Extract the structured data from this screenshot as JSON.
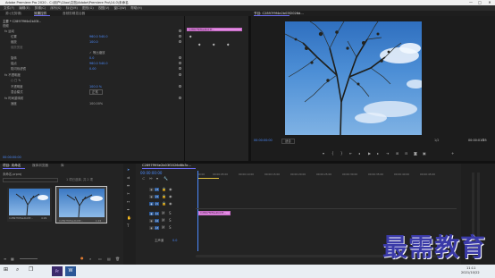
{
  "window": {
    "title": "Adobe Premiere Pro 2020 - C:\\用户\\Ciloo\\文档\\Adobe\\Premiere Pro\\14.0\\未命名",
    "min": "—",
    "max": "□",
    "close": "✕"
  },
  "menu": [
    "文件(F)",
    "编辑(E)",
    "剪辑(C)",
    "序列(S)",
    "标记(M)",
    "图形(G)",
    "视图(V)",
    "窗口(W)",
    "帮助(H)"
  ],
  "effect_controls": {
    "tabs": [
      "源:(无剪辑)",
      "效果控件",
      "音频剪辑混合器"
    ],
    "active_tab": 1,
    "header": "主要 * C2897f9f4e2b03f...",
    "clip_label": "视频",
    "rows": [
      {
        "indent": 0,
        "label": "fx 运动",
        "value": ""
      },
      {
        "indent": 1,
        "label": "位置",
        "value": "960.0    540.0"
      },
      {
        "indent": 1,
        "label": "缩放",
        "value": "100.0"
      },
      {
        "indent": 1,
        "label": "缩放宽度",
        "value": ""
      },
      {
        "indent": 2,
        "label": "",
        "value": "✓ 等比缩放"
      },
      {
        "indent": 1,
        "label": "旋转",
        "value": "0.0"
      },
      {
        "indent": 1,
        "label": "锚点",
        "value": "960.0    540.0"
      },
      {
        "indent": 1,
        "label": "防闪烁滤镜",
        "value": "0.00"
      },
      {
        "indent": 0,
        "label": "fx 不透明度",
        "value": ""
      },
      {
        "indent": 1,
        "label": "○ □ ✎",
        "value": ""
      },
      {
        "indent": 1,
        "label": "不透明度",
        "value": "100.0 %"
      },
      {
        "indent": 1,
        "label": "混合模式",
        "value": "正常"
      },
      {
        "indent": 0,
        "label": "fx 时间重映射",
        "value": ""
      },
      {
        "indent": 1,
        "label": "速度",
        "value": "100.00%"
      }
    ],
    "clip_name": "C2897f9f4e2b03f...",
    "timecode": "00:00:00:00"
  },
  "program_monitor": {
    "tab": "节目: C2897f9f4e2b03f2026d...",
    "timecode": "00:00:00:00",
    "fit": "适合",
    "ratio": "1/2",
    "duration": "00:00:01:15"
  },
  "project": {
    "tabs": [
      "项目: 未命名",
      "媒体浏览器",
      "库"
    ],
    "active_tab": 0,
    "file": "未命名.prproj",
    "count": "1 项已选择, 共 2 项",
    "items": [
      {
        "name": "C2897f9f4e2b03f...",
        "duration": "4:29"
      },
      {
        "name": "C2897f9f4e2b03f...",
        "duration": "1:15"
      }
    ]
  },
  "timeline": {
    "tab": "C2897f9f4e2b03f2026d8b3c...",
    "timecode": "00:00:00:00",
    "ruler": [
      "00:00",
      "00:00:05:00",
      "00:00:10:00",
      "00:00:15:00",
      "00:00:20:00",
      "00:00:25:00",
      "00:00:30:00",
      "00:00:35:00",
      "00:00:40:00",
      "00:00:45:00",
      "00:00:50:00",
      "00:00:55:00",
      "00:01:00:00"
    ],
    "tracks": [
      "V3",
      "V2",
      "V1",
      "A1",
      "A2",
      "A3"
    ],
    "master": "主声道",
    "master_value": "0.0",
    "clip_label": "C2897f9f4e2b03f..."
  },
  "watermark": "最需教育",
  "taskbar": {
    "time": "11:11",
    "date": "2021/10/22"
  },
  "colors": {
    "accent": "#4b8bff",
    "clip": "#e48ce4",
    "watermark": "#3a3aa8"
  }
}
